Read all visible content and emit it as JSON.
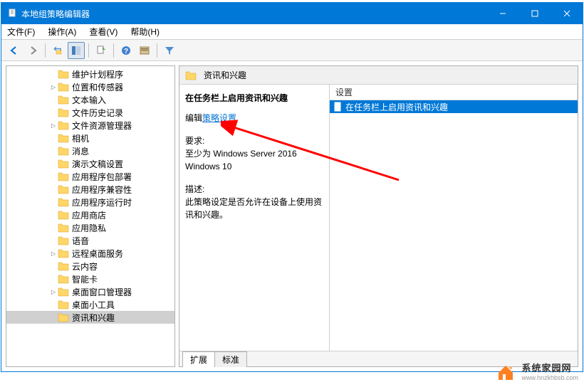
{
  "window": {
    "title": "本地组策略编辑器"
  },
  "menu": {
    "file": "文件(F)",
    "action": "操作(A)",
    "view": "查看(V)",
    "help": "帮助(H)"
  },
  "tree": {
    "items": [
      {
        "label": "维护计划程序",
        "indent": 60,
        "arrow": "none"
      },
      {
        "label": "位置和传感器",
        "indent": 60,
        "arrow": "right"
      },
      {
        "label": "文本输入",
        "indent": 60,
        "arrow": "none"
      },
      {
        "label": "文件历史记录",
        "indent": 60,
        "arrow": "none"
      },
      {
        "label": "文件资源管理器",
        "indent": 60,
        "arrow": "right"
      },
      {
        "label": "相机",
        "indent": 60,
        "arrow": "none"
      },
      {
        "label": "消息",
        "indent": 60,
        "arrow": "none"
      },
      {
        "label": "演示文稿设置",
        "indent": 60,
        "arrow": "none"
      },
      {
        "label": "应用程序包部署",
        "indent": 60,
        "arrow": "none"
      },
      {
        "label": "应用程序兼容性",
        "indent": 60,
        "arrow": "none"
      },
      {
        "label": "应用程序运行时",
        "indent": 60,
        "arrow": "none"
      },
      {
        "label": "应用商店",
        "indent": 60,
        "arrow": "none"
      },
      {
        "label": "应用隐私",
        "indent": 60,
        "arrow": "none"
      },
      {
        "label": "语音",
        "indent": 60,
        "arrow": "none"
      },
      {
        "label": "远程桌面服务",
        "indent": 60,
        "arrow": "right"
      },
      {
        "label": "云内容",
        "indent": 60,
        "arrow": "none"
      },
      {
        "label": "智能卡",
        "indent": 60,
        "arrow": "none"
      },
      {
        "label": "桌面窗口管理器",
        "indent": 60,
        "arrow": "right"
      },
      {
        "label": "桌面小工具",
        "indent": 60,
        "arrow": "none"
      },
      {
        "label": "资讯和兴趣",
        "indent": 60,
        "arrow": "none",
        "selected": true
      }
    ]
  },
  "right": {
    "header": "资讯和兴趣",
    "detail": {
      "title": "在任务栏上启用资讯和兴趣",
      "edit_label": "编辑",
      "edit_link": "策略设置",
      "req_label": "要求:",
      "req_text": "至少为 Windows Server 2016\nWindows 10",
      "desc_label": "描述:",
      "desc_text": "此策略设定是否允许在设备上使用资讯和兴趣。"
    },
    "list": {
      "col_header": "设置",
      "items": [
        {
          "label": "在任务栏上启用资讯和兴趣",
          "selected": true
        }
      ]
    },
    "tabs": {
      "extended": "扩展",
      "standard": "标准"
    }
  },
  "watermark": {
    "brand": "系统家园网",
    "url": "www.hnzkhbsb.com"
  }
}
